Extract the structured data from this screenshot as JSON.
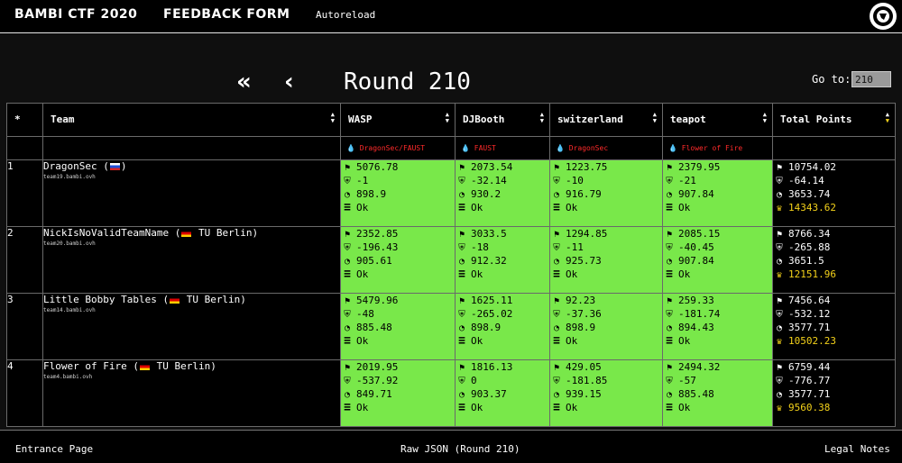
{
  "nav": {
    "brand": "BAMBI CTF 2020",
    "feedback": "FEEDBACK FORM",
    "autoreload": "Autoreload",
    "logo": "enowars-logo"
  },
  "round": {
    "title": "Round 210",
    "goto_label": "Go to:",
    "goto_value": "210",
    "first_icon": "double-chevron-left-icon",
    "prev_icon": "chevron-left-icon"
  },
  "table": {
    "headers": {
      "rank": "*",
      "team": "Team",
      "services": [
        "WASP",
        "DJBooth",
        "switzerland",
        "teapot"
      ],
      "total": "Total Points"
    },
    "attackers": [
      "DragonSec/FAUST",
      "FAUST",
      "DragonSec",
      "Flower of Fire"
    ],
    "rows": [
      {
        "rank": "1",
        "name": "DragonSec (",
        "affiliation": ")",
        "flag": "ru",
        "host": "team19.bambi.ovh",
        "services": [
          {
            "attack": "5076.78",
            "defense": "-1",
            "sla": "898.9",
            "status": "Ok"
          },
          {
            "attack": "2073.54",
            "defense": "-32.14",
            "sla": "930.2",
            "status": "Ok"
          },
          {
            "attack": "1223.75",
            "defense": "-10",
            "sla": "916.79",
            "status": "Ok"
          },
          {
            "attack": "2379.95",
            "defense": "-21",
            "sla": "907.84",
            "status": "Ok"
          }
        ],
        "total": {
          "attack": "10754.02",
          "defense": "-64.14",
          "sla": "3653.74",
          "score": "14343.62"
        }
      },
      {
        "rank": "2",
        "name": "NickIsNoValidTeamName (",
        "affiliation": " TU Berlin)",
        "flag": "de",
        "host": "team20.bambi.ovh",
        "services": [
          {
            "attack": "2352.85",
            "defense": "-196.43",
            "sla": "905.61",
            "status": "Ok"
          },
          {
            "attack": "3033.5",
            "defense": "-18",
            "sla": "912.32",
            "status": "Ok"
          },
          {
            "attack": "1294.85",
            "defense": "-11",
            "sla": "925.73",
            "status": "Ok"
          },
          {
            "attack": "2085.15",
            "defense": "-40.45",
            "sla": "907.84",
            "status": "Ok"
          }
        ],
        "total": {
          "attack": "8766.34",
          "defense": "-265.88",
          "sla": "3651.5",
          "score": "12151.96"
        }
      },
      {
        "rank": "3",
        "name": "Little Bobby Tables (",
        "affiliation": " TU Berlin)",
        "flag": "de",
        "host": "team14.bambi.ovh",
        "services": [
          {
            "attack": "5479.96",
            "defense": "-48",
            "sla": "885.48",
            "status": "Ok"
          },
          {
            "attack": "1625.11",
            "defense": "-265.02",
            "sla": "898.9",
            "status": "Ok"
          },
          {
            "attack": "92.23",
            "defense": "-37.36",
            "sla": "898.9",
            "status": "Ok"
          },
          {
            "attack": "259.33",
            "defense": "-181.74",
            "sla": "894.43",
            "status": "Ok"
          }
        ],
        "total": {
          "attack": "7456.64",
          "defense": "-532.12",
          "sla": "3577.71",
          "score": "10502.23"
        }
      },
      {
        "rank": "4",
        "name": "Flower of Fire (",
        "affiliation": " TU Berlin)",
        "flag": "de",
        "host": "team4.bambi.ovh",
        "services": [
          {
            "attack": "2019.95",
            "defense": "-537.92",
            "sla": "849.71",
            "status": "Ok"
          },
          {
            "attack": "1816.13",
            "defense": "0",
            "sla": "903.37",
            "status": "Ok"
          },
          {
            "attack": "429.05",
            "defense": "-181.85",
            "sla": "939.15",
            "status": "Ok"
          },
          {
            "attack": "2494.32",
            "defense": "-57",
            "sla": "885.48",
            "status": "Ok"
          }
        ],
        "total": {
          "attack": "6759.44",
          "defense": "-776.77",
          "sla": "3577.71",
          "score": "9560.38"
        }
      }
    ]
  },
  "footer": {
    "entrance": "Entrance Page",
    "raw_json": "Raw JSON (Round 210)",
    "legal": "Legal Notes"
  },
  "colors": {
    "service_ok": "#79e84a",
    "attacker_text": "#ff2a2a",
    "total_highlight": "#f4d21a",
    "background": "#0f0f0f"
  }
}
